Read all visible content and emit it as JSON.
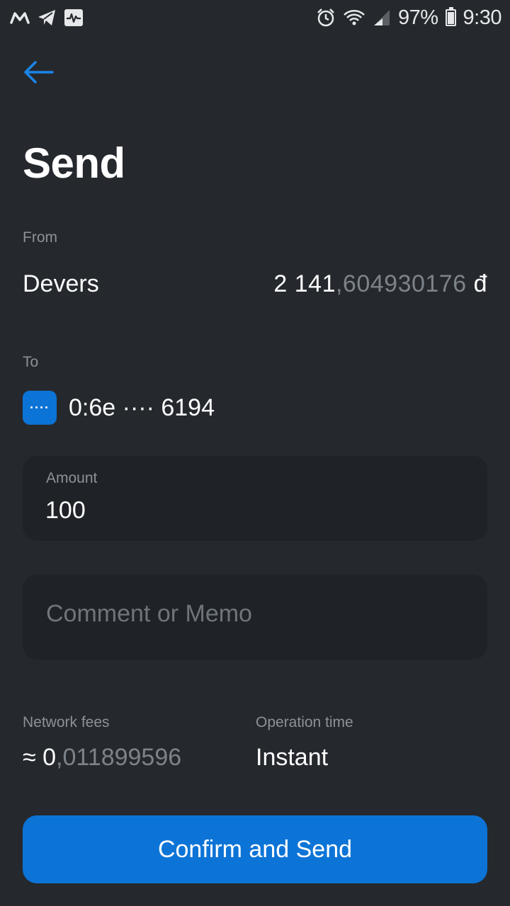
{
  "status_bar": {
    "battery": "97%",
    "time": "9:30",
    "icons": [
      "gmail-icon",
      "telegram-icon",
      "activity-icon",
      "alarm-icon",
      "wifi-icon",
      "signal-icon",
      "battery-icon"
    ]
  },
  "header": {
    "back_icon": "arrow-left-icon",
    "title": "Send"
  },
  "from": {
    "label": "From",
    "account_name": "Devers",
    "balance_int": "2 141",
    "balance_frac": ",604930176",
    "currency": "đ"
  },
  "to": {
    "label": "To",
    "avatar_text": "····",
    "address": "0:6e ···· 6194"
  },
  "amount": {
    "label": "Amount",
    "value": "100"
  },
  "memo": {
    "placeholder": "Comment or Memo"
  },
  "fees": {
    "label": "Network fees",
    "approx": "≈",
    "int": "0",
    "frac": ",011899596"
  },
  "operation_time": {
    "label": "Operation time",
    "value": "Instant"
  },
  "confirm_label": "Confirm and Send",
  "colors": {
    "background": "#25292e",
    "field": "#1f2327",
    "accent": "#0c74d6",
    "muted": "#8c9299"
  }
}
